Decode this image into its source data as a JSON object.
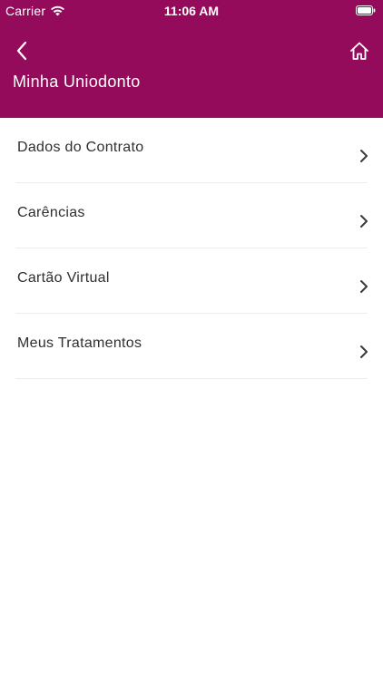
{
  "status_bar": {
    "carrier": "Carrier",
    "time": "11:06 AM"
  },
  "header": {
    "title": "Minha Uniodonto",
    "background_color": "#950B5B",
    "back_icon": "chevron-left-icon",
    "home_icon": "home-icon"
  },
  "menu": {
    "items": [
      {
        "label": "Dados do Contrato"
      },
      {
        "label": "Carências"
      },
      {
        "label": "Cartão Virtual"
      },
      {
        "label": "Meus Tratamentos"
      }
    ]
  }
}
